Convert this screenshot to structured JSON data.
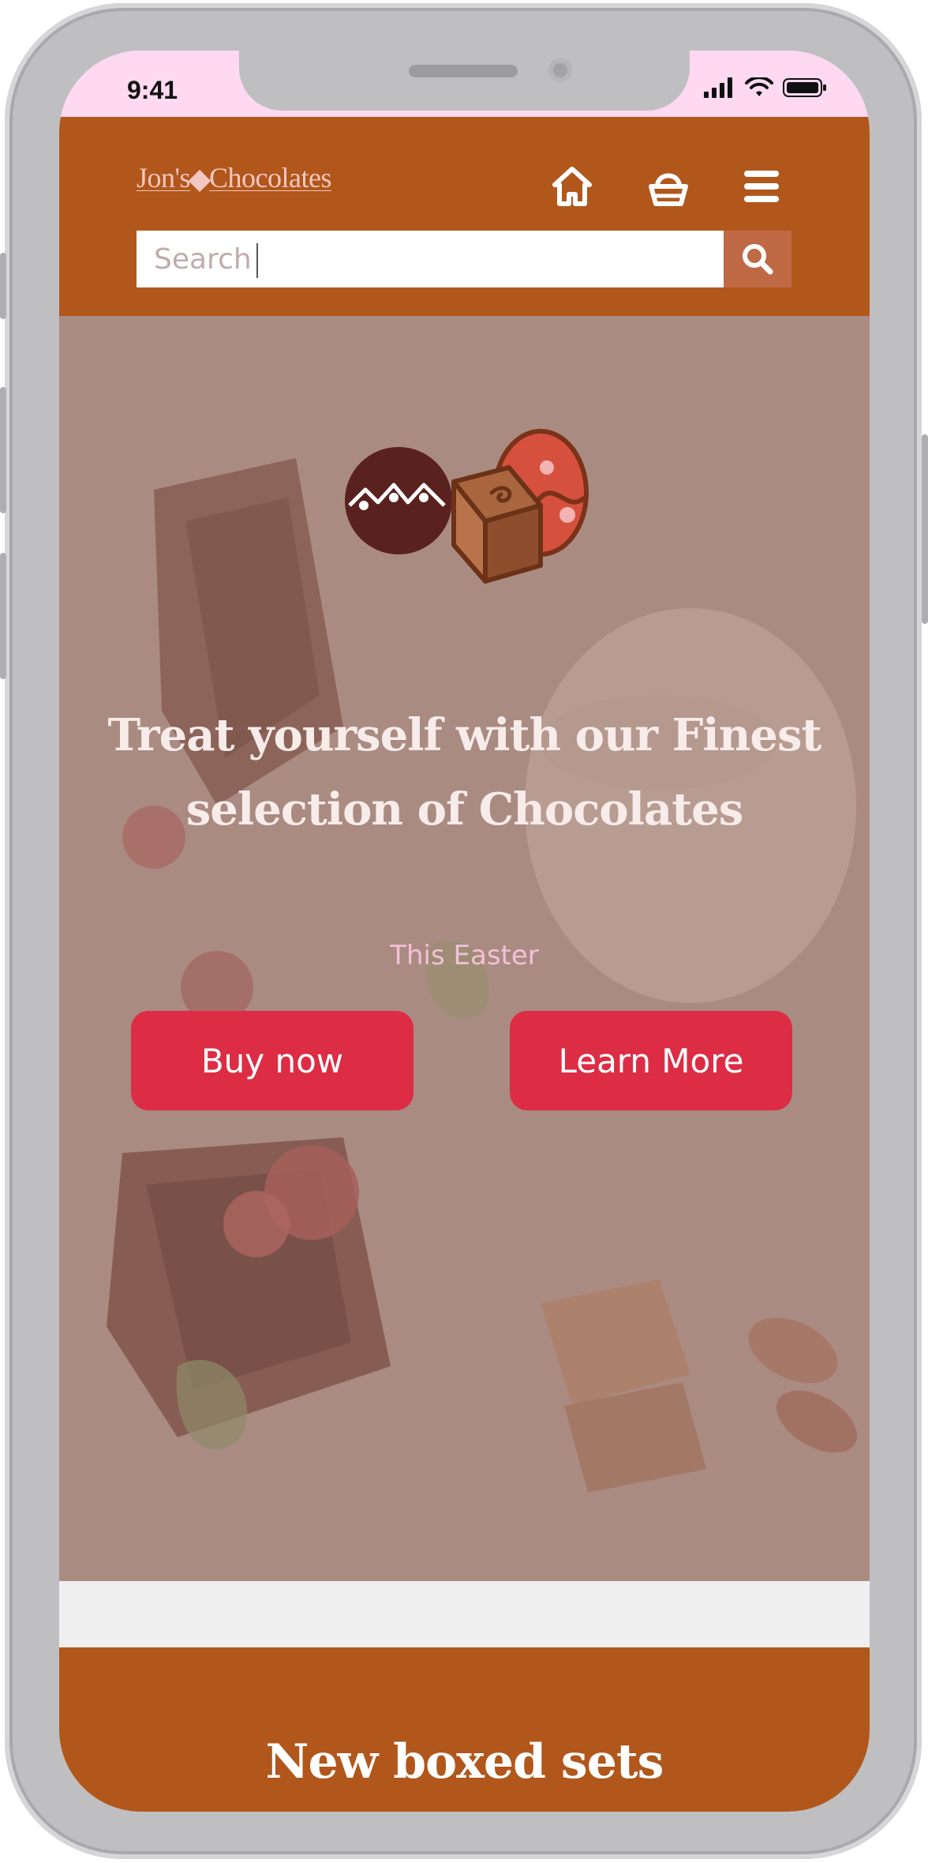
{
  "status_bar": {
    "time": "9:41"
  },
  "header": {
    "logo_part1": "Jon's",
    "logo_part2": "Chocolates",
    "icons": [
      "home-icon",
      "basket-icon",
      "menu-icon"
    ],
    "search": {
      "placeholder": "Search",
      "button_icon": "search-icon"
    }
  },
  "hero": {
    "title": "Treat yourself with our Finest selection of Chocolates",
    "subtitle": "This Easter",
    "buttons": {
      "buy": "Buy now",
      "learn": "Learn More"
    },
    "illustration_icons": [
      "truffle-icon",
      "chocolate-cube-icon",
      "easter-egg-icon"
    ]
  },
  "section": {
    "title": "New boxed sets"
  },
  "colors": {
    "header_bg": "#b1571c",
    "status_bar_bg": "#ffd9f1",
    "button_bg": "#dc2d45",
    "hero_overlay": "#a98a80",
    "subtitle": "#f2c0d8"
  }
}
